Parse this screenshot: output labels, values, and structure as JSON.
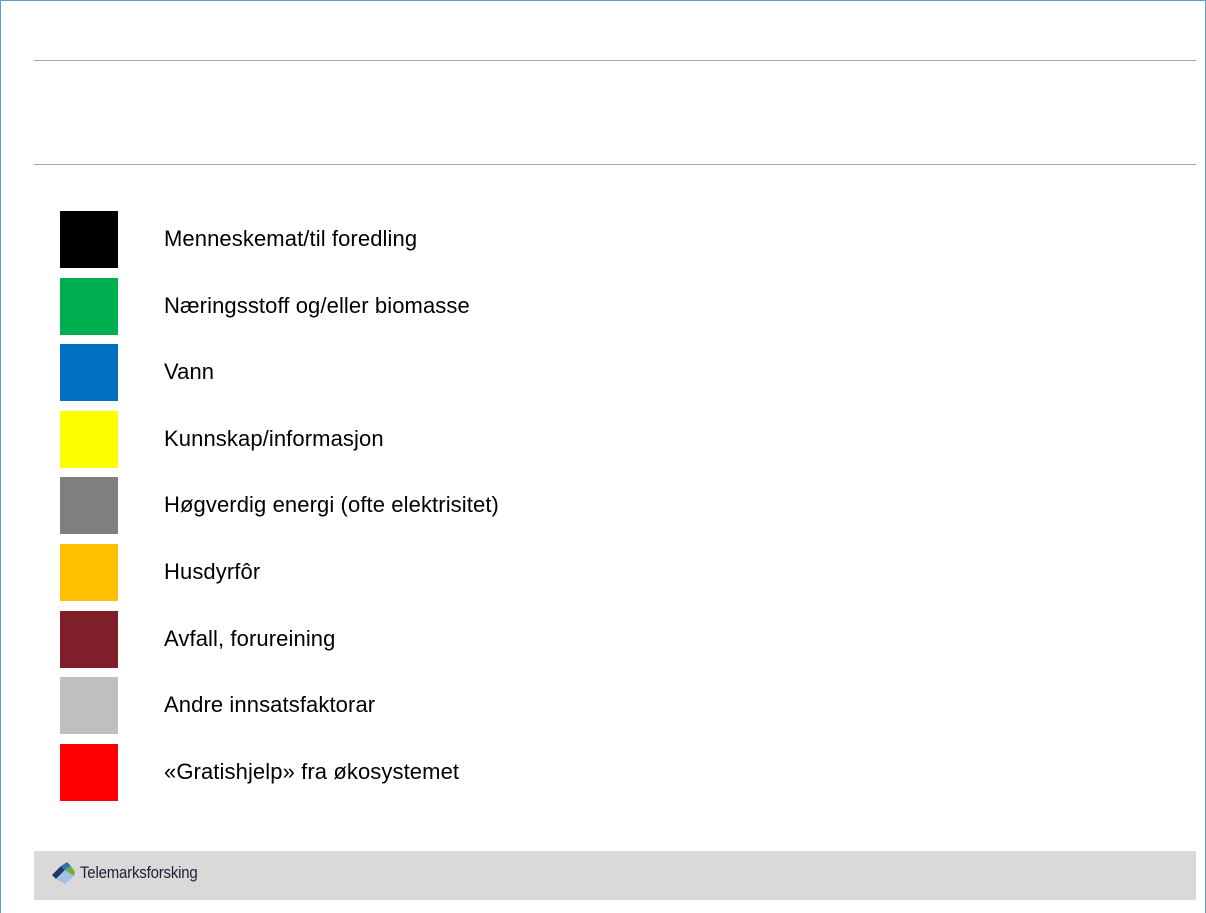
{
  "legend": {
    "items": [
      {
        "label": "Menneskemat/til foredling",
        "color": "#000000"
      },
      {
        "label": "Næringsstoff og/eller biomasse",
        "color": "#00b050"
      },
      {
        "label": "Vann",
        "color": "#0070c0"
      },
      {
        "label": "Kunnskap/informasjon",
        "color": "#ffff00"
      },
      {
        "label": "Høgverdig energi (ofte elektrisitet)",
        "color": "#7f7f7f"
      },
      {
        "label": "Husdyrfôr",
        "color": "#ffc000"
      },
      {
        "label": "Avfall, forureining",
        "color": "#7f1f2a"
      },
      {
        "label": "Andre innsatsfaktorar",
        "color": "#bfbfbf"
      },
      {
        "label": "«Gratishjelp» fra økosystemet",
        "color": "#ff0000"
      }
    ]
  },
  "footer": {
    "logo_text": "Telemarksforsking",
    "logo_icon": "telemarksforsking-logo-icon",
    "background": "#d9d9d9"
  }
}
